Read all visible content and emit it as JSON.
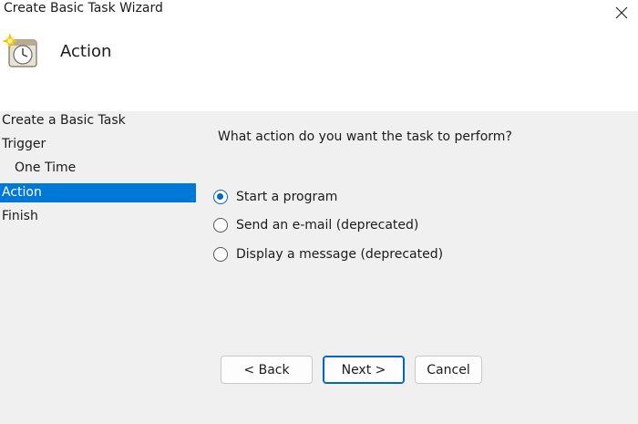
{
  "window": {
    "title": "Create Basic Task Wizard"
  },
  "header": {
    "title": "Action",
    "icon": "task-scheduler-clock-icon"
  },
  "steps": [
    {
      "label": "Create a Basic Task",
      "indent": false,
      "selected": false
    },
    {
      "label": "Trigger",
      "indent": false,
      "selected": false
    },
    {
      "label": "One Time",
      "indent": true,
      "selected": false
    },
    {
      "label": "Action",
      "indent": false,
      "selected": true
    },
    {
      "label": "Finish",
      "indent": false,
      "selected": false
    }
  ],
  "main": {
    "question": "What action do you want the task to perform?",
    "options": [
      {
        "label": "Start a program",
        "checked": true
      },
      {
        "label": "Send an e-mail (deprecated)",
        "checked": false
      },
      {
        "label": "Display a message (deprecated)",
        "checked": false
      }
    ]
  },
  "buttons": {
    "back": "< Back",
    "next": "Next >",
    "cancel": "Cancel"
  },
  "colors": {
    "selection": "#0078d7",
    "radio_accent": "#0067c0",
    "panel_background": "#f0f0f0"
  }
}
